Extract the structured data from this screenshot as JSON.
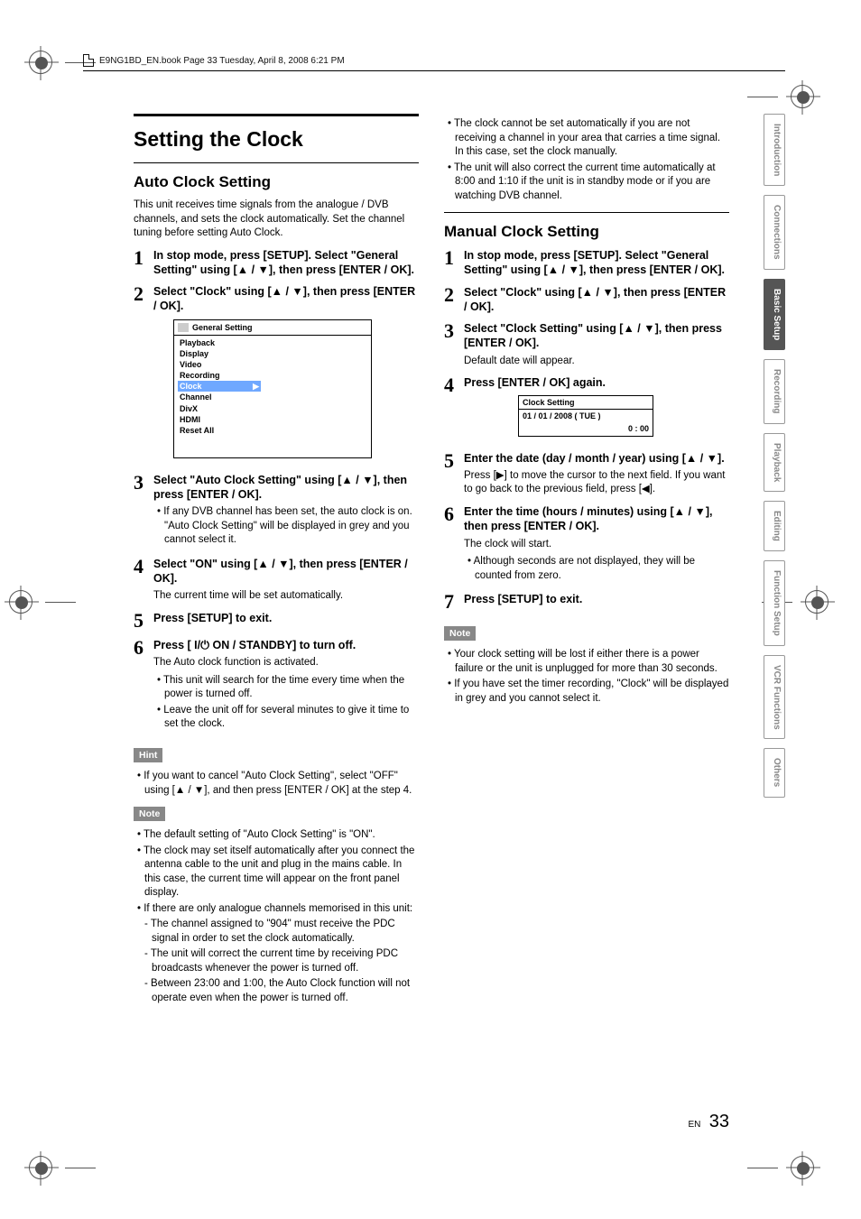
{
  "header": {
    "book_line": "E9NG1BD_EN.book  Page 33  Tuesday, April 8, 2008  6:21 PM"
  },
  "title": "Setting the Clock",
  "auto": {
    "heading": "Auto Clock Setting",
    "intro": "This unit receives time signals from the analogue / DVB channels, and sets the clock automatically. Set the channel tuning before setting Auto Clock.",
    "steps": [
      {
        "n": "1",
        "head": "In stop mode, press [SETUP]. Select \"General Setting\" using [▲ / ▼], then press [ENTER / OK]."
      },
      {
        "n": "2",
        "head": "Select \"Clock\" using [▲ / ▼], then press [ENTER / OK]."
      },
      {
        "n": "3",
        "head": "Select \"Auto Clock Setting\" using [▲ / ▼], then press [ENTER / OK].",
        "bullets": [
          "If any DVB channel has been set, the auto clock is on. \"Auto Clock Setting\" will be displayed in grey and you cannot select it."
        ]
      },
      {
        "n": "4",
        "head": "Select \"ON\" using [▲ / ▼], then press [ENTER / OK].",
        "sub": "The current time will be set automatically."
      },
      {
        "n": "5",
        "head": "Press [SETUP] to exit."
      },
      {
        "n": "6",
        "head": "Press [ I/⏻ ON / STANDBY] to turn off.",
        "sub": "The Auto clock function is activated.",
        "bullets": [
          "This unit will search for the time every time when the power is turned off.",
          "Leave the unit off for several minutes to give it time to set the clock."
        ]
      }
    ],
    "menu": {
      "title": "General Setting",
      "items": [
        "Playback",
        "Display",
        "Video",
        "Recording",
        "Clock",
        "Channel",
        "DivX",
        "HDMI",
        "Reset All"
      ],
      "selected": "Clock"
    },
    "hint": {
      "label": "Hint",
      "items": [
        "If you want to cancel \"Auto Clock Setting\", select \"OFF\" using [▲ / ▼], and then press [ENTER / OK] at the step 4."
      ]
    },
    "note": {
      "label": "Note",
      "items": [
        "The default setting of \"Auto Clock Setting\" is \"ON\".",
        "The clock may set itself automatically after you connect the antenna cable to the unit and plug in the mains cable. In this case, the current time will appear on the front panel display.",
        "If there are only analogue channels memorised in this unit:"
      ],
      "dashes": [
        "The channel assigned to \"904\" must receive the PDC signal in order to set the clock automatically.",
        "The unit will correct the current time by receiving PDC broadcasts whenever the power is turned off.",
        "Between 23:00 and 1:00, the Auto Clock function will not operate even when the power is turned off."
      ]
    }
  },
  "col2_top": [
    "The clock cannot be set automatically if you are not receiving a channel in your area that carries a time signal. In this case, set the clock manually.",
    "The unit will also correct the current time automatically at 8:00 and 1:10 if the unit is in standby mode or if you are watching DVB channel."
  ],
  "manual": {
    "heading": "Manual Clock Setting",
    "steps": [
      {
        "n": "1",
        "head": "In stop mode, press [SETUP]. Select \"General Setting\" using [▲ / ▼], then press [ENTER / OK]."
      },
      {
        "n": "2",
        "head": "Select \"Clock\" using [▲ / ▼], then press [ENTER / OK]."
      },
      {
        "n": "3",
        "head": "Select \"Clock Setting\" using [▲ / ▼], then press [ENTER / OK].",
        "sub": "Default date will appear."
      },
      {
        "n": "4",
        "head": "Press [ENTER / OK] again."
      },
      {
        "n": "5",
        "head": "Enter the date (day / month / year) using [▲ / ▼].",
        "sub": "Press [▶] to move the cursor to the next field. If you want to go back to the previous field, press [◀]."
      },
      {
        "n": "6",
        "head": "Enter the time (hours / minutes) using [▲ / ▼], then press [ENTER / OK].",
        "sub": "The clock will start.",
        "bullets": [
          "Although seconds are not displayed, they will be counted from zero."
        ]
      },
      {
        "n": "7",
        "head": "Press [SETUP] to exit."
      }
    ],
    "clockbox": {
      "title": "Clock Setting",
      "line1": "01 / 01 / 2008 ( TUE )",
      "line2": "0 : 00"
    },
    "note": {
      "label": "Note",
      "items": [
        "Your clock setting will be lost if either there is a power failure or the unit is unplugged for more than 30 seconds.",
        "If you have set the timer recording, \"Clock\" will be displayed in grey and you cannot select it."
      ]
    }
  },
  "tabs": [
    {
      "label": "Introduction",
      "active": false
    },
    {
      "label": "Connections",
      "active": false
    },
    {
      "label": "Basic Setup",
      "active": true
    },
    {
      "label": "Recording",
      "active": false
    },
    {
      "label": "Playback",
      "active": false
    },
    {
      "label": "Editing",
      "active": false
    },
    {
      "label": "Function Setup",
      "active": false
    },
    {
      "label": "VCR Functions",
      "active": false
    },
    {
      "label": "Others",
      "active": false
    }
  ],
  "footer": {
    "lang": "EN",
    "page": "33"
  }
}
